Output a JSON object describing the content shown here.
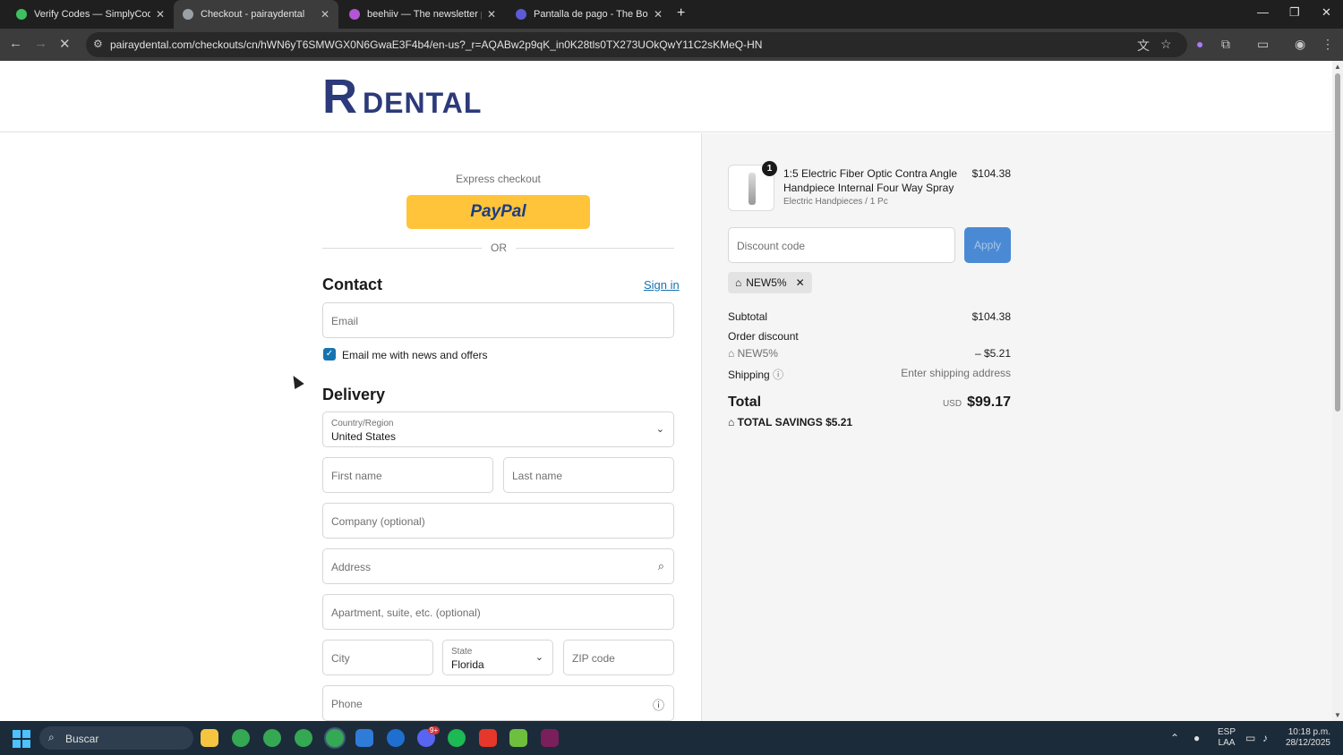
{
  "browser": {
    "tabs": [
      {
        "title": "Verify Codes — SimplyCodes",
        "color": "#3fbf5f"
      },
      {
        "title": "Checkout - pairaydental",
        "color": "#9aa0a6"
      },
      {
        "title": "beehiiv — The newsletter platfo",
        "color": "#b455d6"
      },
      {
        "title": "Pantalla de pago - The Boho Bo",
        "color": "#5b5bd6"
      }
    ],
    "url": "pairaydental.com/checkouts/cn/hWN6yT6SMWGX0N6GwaE3F4b4/en-us?_r=AQABw2p9qK_in0K28tls0TX273UOkQwY11C2sKMeQ-HN"
  },
  "store": {
    "logo_letter": "R",
    "logo_word": "DENTAL"
  },
  "checkout": {
    "express_label": "Express checkout",
    "paypal_label": "PayPal",
    "or_label": "OR",
    "contact_heading": "Contact",
    "sign_in": "Sign in",
    "email_placeholder": "Email",
    "newsletter_label": "Email me with news and offers",
    "newsletter_checked": true,
    "delivery_heading": "Delivery",
    "country_label": "Country/Region",
    "country_value": "United States",
    "first_name_placeholder": "First name",
    "last_name_placeholder": "Last name",
    "company_placeholder": "Company (optional)",
    "address_placeholder": "Address",
    "apartment_placeholder": "Apartment, suite, etc. (optional)",
    "city_placeholder": "City",
    "state_label": "State",
    "state_value": "Florida",
    "zip_placeholder": "ZIP code",
    "phone_placeholder": "Phone"
  },
  "summary": {
    "item": {
      "qty": "1",
      "name": "1:5 Electric Fiber Optic Contra Angle Handpiece Internal Four Way Spray",
      "variant": "Electric Handpieces / 1 Pc",
      "price": "$104.38"
    },
    "discount_placeholder": "Discount code",
    "apply_label": "Apply",
    "applied_code": "NEW5%",
    "subtotal_label": "Subtotal",
    "subtotal_value": "$104.38",
    "order_discount_label": "Order discount",
    "discount_code": "NEW5%",
    "discount_value": "– $5.21",
    "shipping_label": "Shipping",
    "shipping_value": "Enter shipping address",
    "total_label": "Total",
    "currency": "USD",
    "total_value": "$99.17",
    "savings_label": "TOTAL SAVINGS",
    "savings_value": "$5.21"
  },
  "taskbar": {
    "search_placeholder": "Buscar",
    "lang_top": "ESP",
    "lang_bottom": "LAA",
    "time": "10:18 p.m.",
    "date": "28/12/2025",
    "badge": "9+"
  },
  "colors": {
    "accent": "#1773b0",
    "paypal": "#ffc439",
    "brand": "#2c3a7a"
  }
}
